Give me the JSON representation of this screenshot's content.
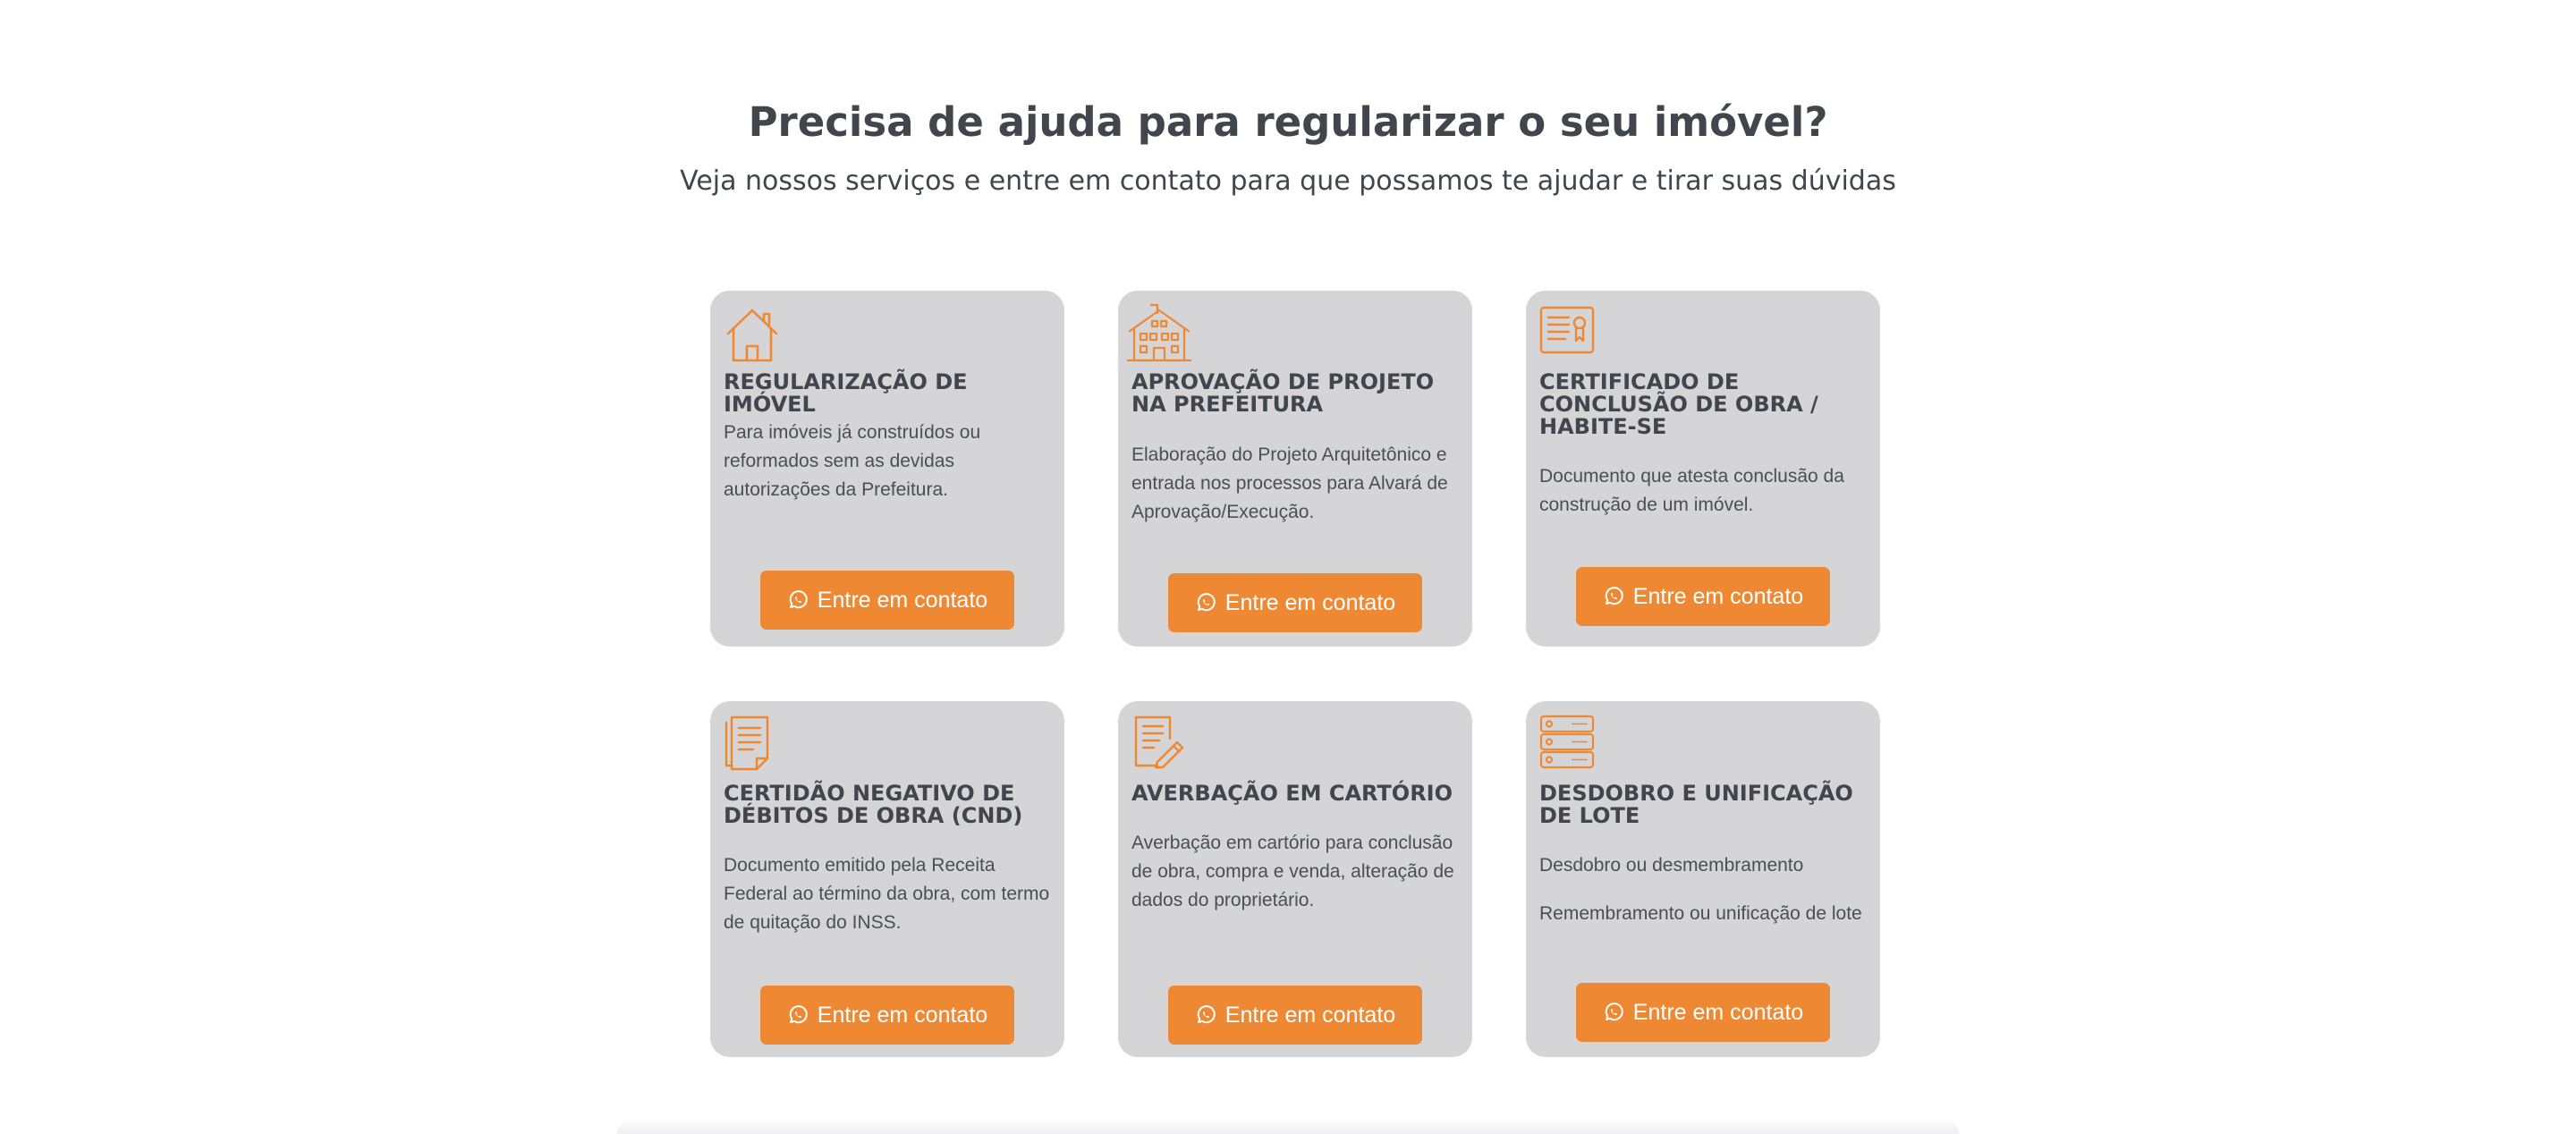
{
  "header": {
    "title": "Precisa de ajuda para regularizar o seu imóvel?",
    "subtitle": "Veja nossos serviços e entre em contato para que possamos te ajudar e tirar suas dúvidas"
  },
  "colors": {
    "accent": "#ef8833",
    "card_bg": "#d5d5d8",
    "heading": "#41454c"
  },
  "services": [
    {
      "icon": "house-icon",
      "title": "REGULARIZAÇÃO DE IMÓVEL",
      "description": [
        "Para imóveis já construídos ou reformados sem as devidas autorizações da Prefeitura."
      ],
      "cta": "Entre em contato"
    },
    {
      "icon": "building-icon",
      "title": "APROVAÇÃO DE PROJETO NA PREFEITURA",
      "description": [
        "Elaboração do Projeto Arquitetônico e entrada nos processos para Alvará de Aprovação/Execução."
      ],
      "cta": "Entre em contato"
    },
    {
      "icon": "certificate-icon",
      "title": "CERTIFICADO DE CONCLUSÃO DE OBRA / HABITE-SE",
      "description": [
        "Documento que atesta conclusão da construção de um imóvel."
      ],
      "cta": "Entre em contato"
    },
    {
      "icon": "document-icon",
      "title": "CERTIDÃO NEGATIVO DE DÉBITOS DE OBRA (CND)",
      "description": [
        "Documento emitido pela Receita Federal ao término da obra, com termo de quitação do INSS."
      ],
      "cta": "Entre em contato"
    },
    {
      "icon": "document-signature-icon",
      "title": "AVERBAÇÃO EM CARTÓRIO",
      "description": [
        "Averbação em cartório para conclusão de obra, compra e venda, alteração de dados do proprietário."
      ],
      "cta": "Entre em contato"
    },
    {
      "icon": "checklist-icon",
      "title": "DESDOBRO E UNIFICAÇÃO DE LOTE",
      "description": [
        "Desdobro ou desmembramento",
        "Remembramento ou unificação de lote"
      ],
      "cta": "Entre em contato"
    }
  ]
}
